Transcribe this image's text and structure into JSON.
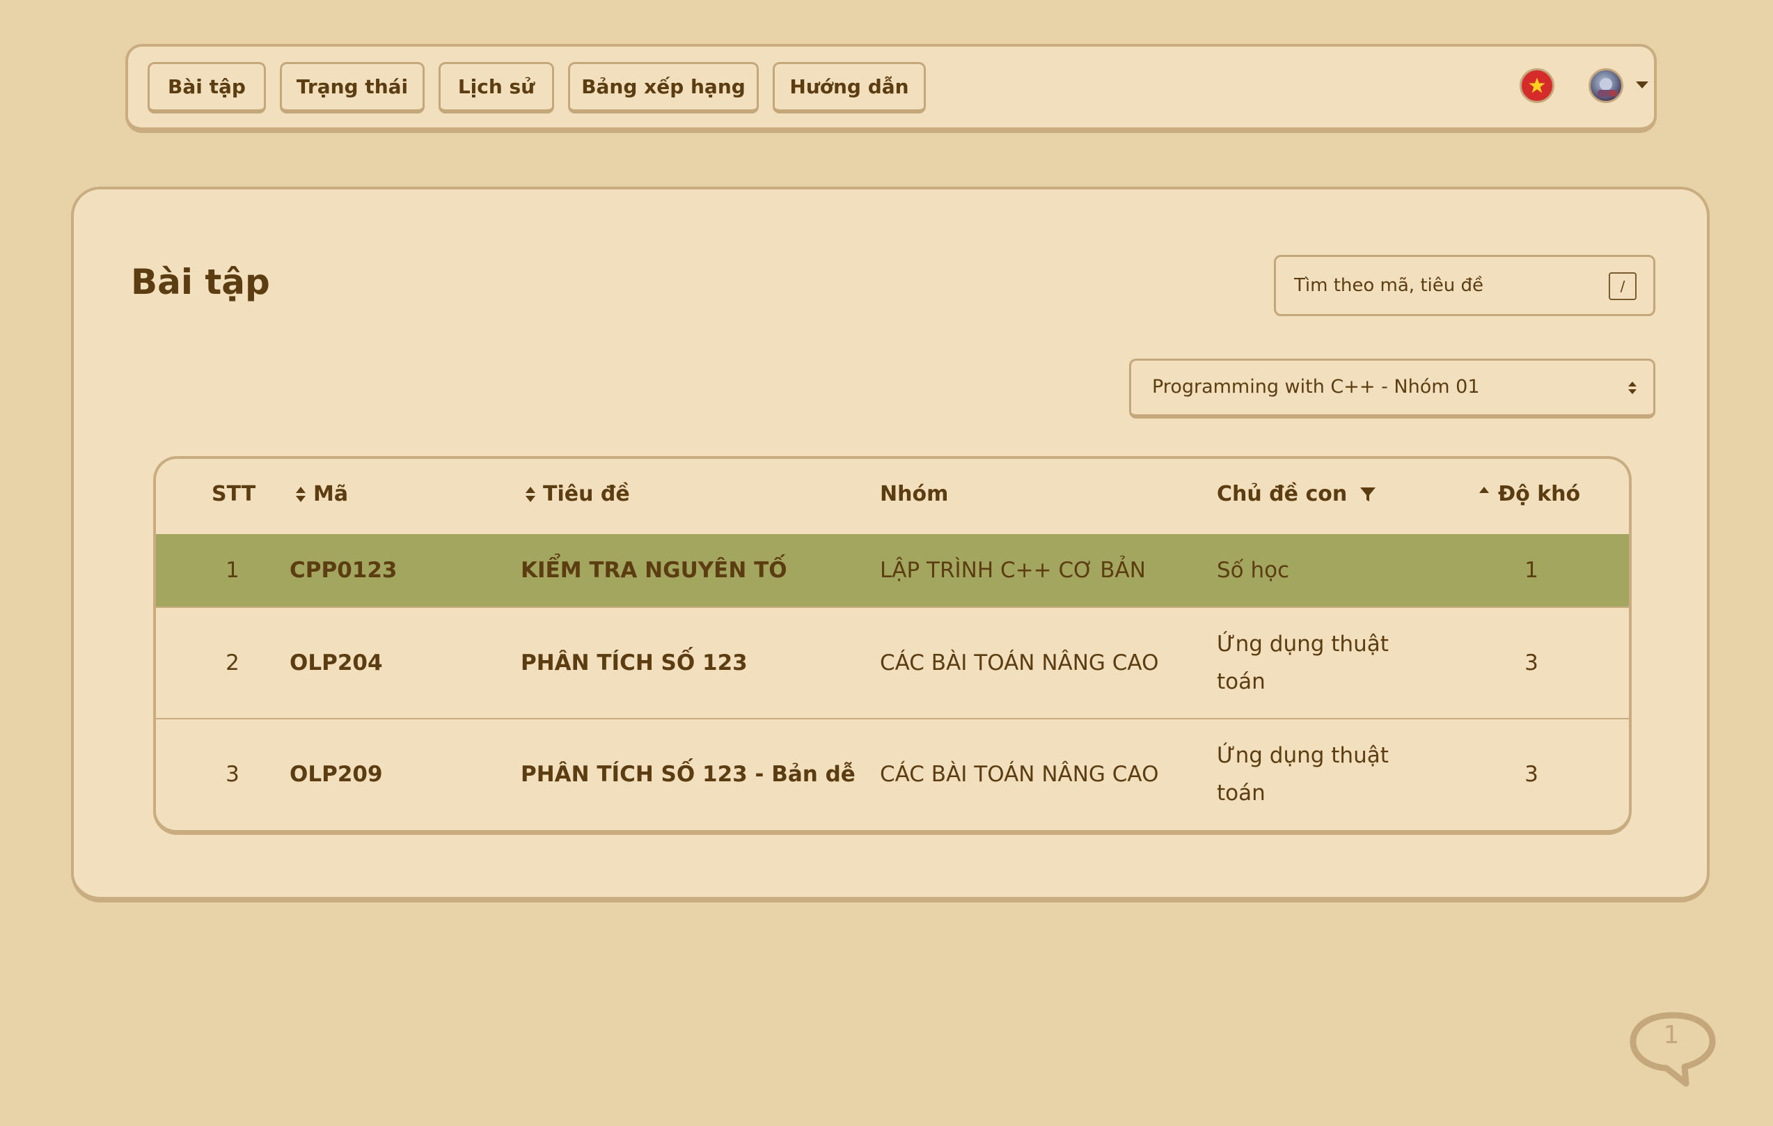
{
  "nav": {
    "items": [
      {
        "label": "Bài tập"
      },
      {
        "label": "Trạng thái"
      },
      {
        "label": "Lịch sử"
      },
      {
        "label": "Bảng xếp hạng"
      },
      {
        "label": "Hướng dẫn"
      }
    ],
    "flag_icon": "vietnam-flag-icon",
    "avatar_icon": "user-avatar"
  },
  "page": {
    "title": "Bài tập"
  },
  "search": {
    "placeholder": "Tìm theo mã, tiêu đề",
    "shortcut": "/"
  },
  "group_select": {
    "selected": "Programming with C++ - Nhóm 01"
  },
  "table": {
    "headers": {
      "stt": "STT",
      "ma": "Mã",
      "title": "Tiêu đề",
      "nhom": "Nhóm",
      "chude": "Chủ đề con",
      "dokho": "Độ khó"
    },
    "rows": [
      {
        "stt": "1",
        "ma": "CPP0123",
        "title": "KIỂM TRA NGUYÊN TỐ",
        "nhom": "LẬP TRÌNH C++ CƠ BẢN",
        "chude": "Số học",
        "dokho": "1"
      },
      {
        "stt": "2",
        "ma": "OLP204",
        "title": "PHÂN TÍCH SỐ 123",
        "nhom": "CÁC BÀI TOÁN NÂNG CAO",
        "chude": "Ứng dụng thuật toán",
        "dokho": "3"
      },
      {
        "stt": "3",
        "ma": "OLP209",
        "title": "PHÂN TÍCH SỐ 123 - Bản dễ",
        "nhom": "CÁC BÀI TOÁN NÂNG CAO",
        "chude": "Ứng dụng thuật toán",
        "dokho": "3"
      }
    ],
    "highlight_color": "#a3a65f"
  },
  "chat": {
    "count": "1"
  },
  "colors": {
    "background": "#e8d3a9",
    "surface": "#f1dfbd",
    "border": "#c9ad80",
    "text": "#5c3d12"
  }
}
